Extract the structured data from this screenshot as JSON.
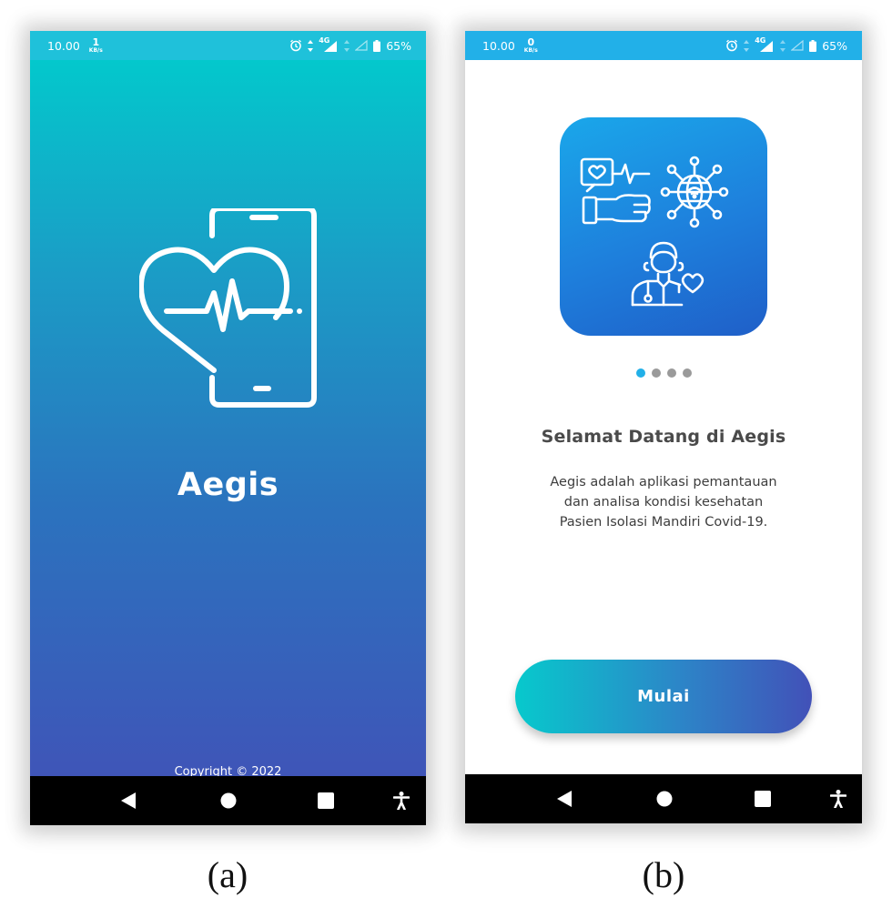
{
  "figure": {
    "panels": [
      {
        "caption": "(a)",
        "statusbar": {
          "time": "10.00",
          "speed_value": "1",
          "speed_unit": "KB/s",
          "network": "4G",
          "battery": "65%"
        },
        "app_name": "Aegis",
        "copyright": "Copyright © 2022"
      },
      {
        "caption": "(b)",
        "statusbar": {
          "time": "10.00",
          "speed_value": "0",
          "speed_unit": "KB/s",
          "network": "4G",
          "battery": "65%"
        },
        "pager": {
          "total": 4,
          "active_index": 0
        },
        "title": "Selamat Datang di Aegis",
        "description_lines": [
          "Aegis adalah aplikasi pemantauan",
          "dan analisa kondisi kesehatan",
          "Pasien Isolasi Mandiri Covid-19."
        ],
        "start_button": "Mulai"
      }
    ]
  },
  "icons": {
    "splash_logo": "heart-phone-pulse-icon",
    "illustration": [
      "health-monitor-icon",
      "network-globe-icon",
      "doctor-icon"
    ],
    "nav": [
      "back-icon",
      "home-icon",
      "recents-icon",
      "accessibility-icon"
    ],
    "status": [
      "alarm-icon",
      "signal-icon",
      "battery-icon"
    ]
  },
  "colors": {
    "accent": "#22b0e8",
    "gradient_top": "#03c8cc",
    "gradient_bottom": "#3f55b8",
    "title_text": "#4a4a4a"
  }
}
